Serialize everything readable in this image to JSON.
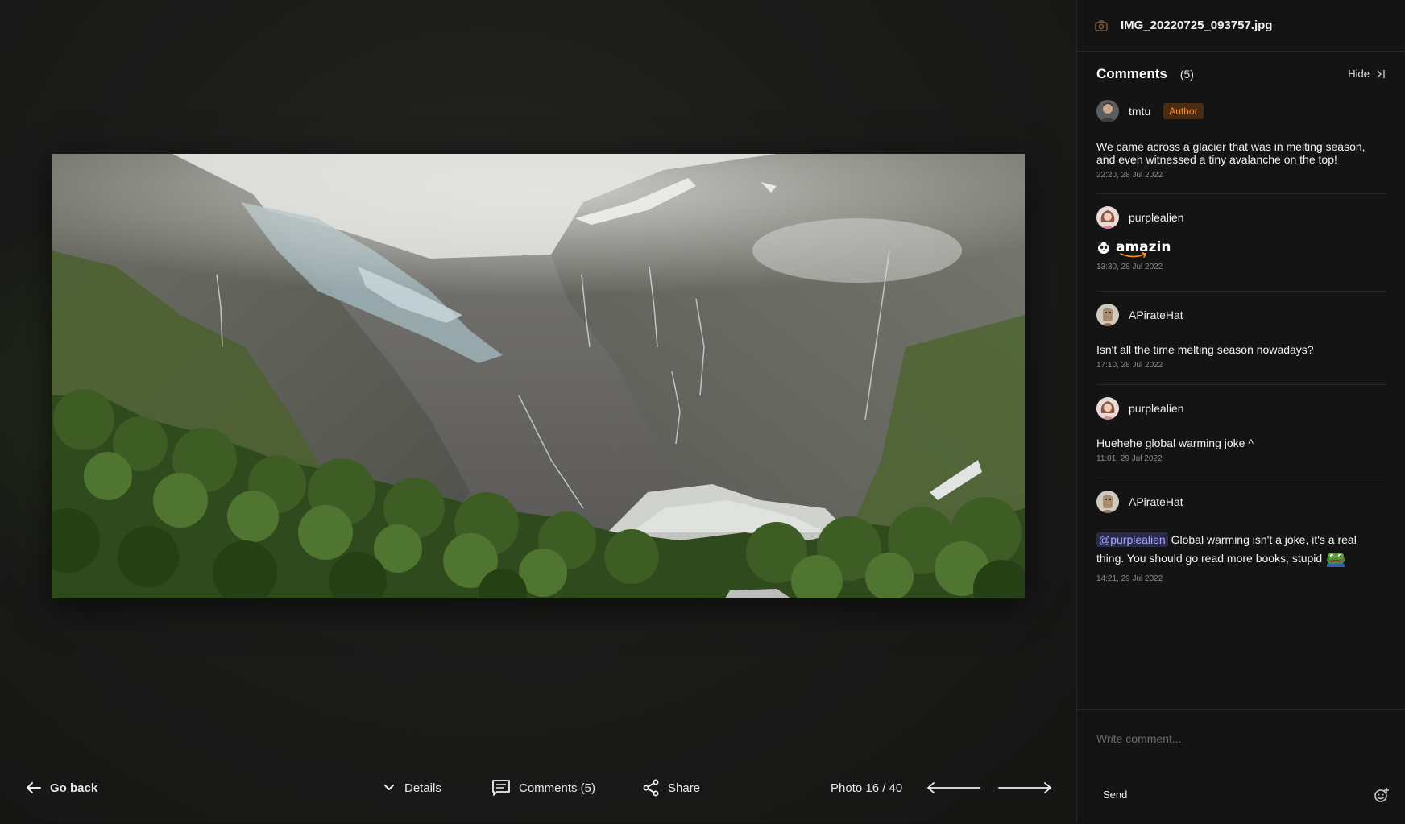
{
  "viewer": {
    "file_name": "IMG_20220725_093757.jpg",
    "photo_alt": "Glacier valley with waterfalls and forest"
  },
  "toolbar": {
    "go_back": "Go back",
    "details": "Details",
    "comments": "Comments (5)",
    "share": "Share",
    "photo_position": "Photo 16 / 40"
  },
  "sidebar": {
    "comments_title": "Comments",
    "comments_count": "(5)",
    "hide_label": "Hide",
    "comments": [
      {
        "user": "tmtu",
        "badge": "Author",
        "text": "We came across a glacier that was in melting season, and even witnessed a tiny avalanche on the top!",
        "time": "22:20, 28 Jul 2022"
      },
      {
        "user": "purplealien",
        "sticker": "amazin",
        "time": "13:30, 28 Jul 2022"
      },
      {
        "user": "APirateHat",
        "text": "Isn't all the time melting season nowadays?",
        "time": "17:10, 28 Jul 2022"
      },
      {
        "user": "purplealien",
        "text": "Huehehe global warming joke ^",
        "time": "11:01, 29 Jul 2022"
      },
      {
        "user": "APirateHat",
        "mention": "@purplealien",
        "text": "Global warming isn't a joke, it's a real thing. You should go read more books, stupid",
        "time": "14:21, 29 Jul 2022"
      }
    ],
    "compose_placeholder": "Write comment...",
    "send_label": "Send"
  },
  "colors": {
    "accent_badge_text": "#ff8a35",
    "accent_badge_bg": "#4a2c13",
    "mention_text": "#a8a5ff",
    "background": "#141414"
  }
}
